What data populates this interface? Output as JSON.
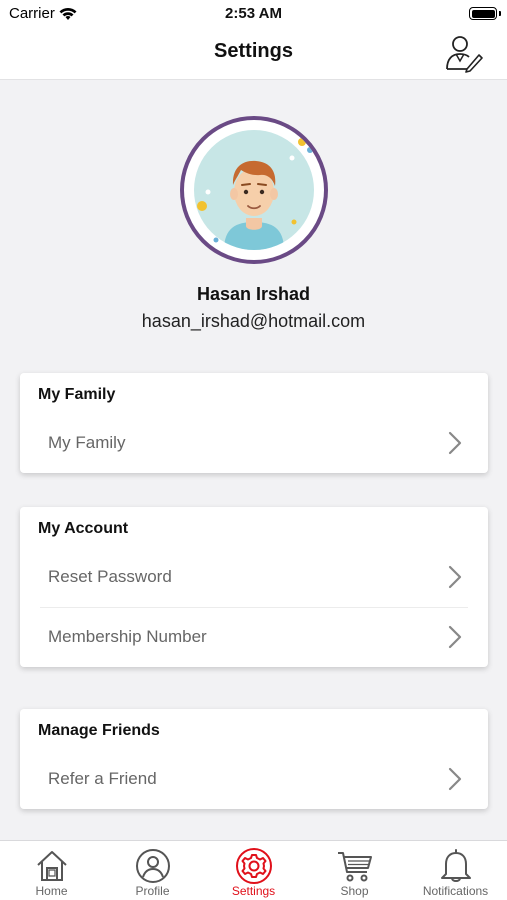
{
  "status": {
    "carrier": "Carrier",
    "time": "2:53 AM"
  },
  "nav": {
    "title": "Settings"
  },
  "user": {
    "name": "Hasan Irshad",
    "email": "hasan_irshad@hotmail.com"
  },
  "sections": [
    {
      "header": "My Family",
      "items": [
        "My Family"
      ]
    },
    {
      "header": "My Account",
      "items": [
        "Reset Password",
        "Membership Number"
      ]
    },
    {
      "header": "Manage Friends",
      "items": [
        "Refer a Friend"
      ]
    }
  ],
  "tabs": [
    {
      "label": "Home",
      "icon": "home-icon"
    },
    {
      "label": "Profile",
      "icon": "profile-icon"
    },
    {
      "label": "Settings",
      "icon": "gear-icon",
      "active": true
    },
    {
      "label": "Shop",
      "icon": "cart-icon"
    },
    {
      "label": "Notifications",
      "icon": "bell-icon"
    }
  ],
  "colors": {
    "active_tab": "#e0101a",
    "avatar_ring": "#6a4a85",
    "avatar_bg": "#c7e6e6"
  }
}
